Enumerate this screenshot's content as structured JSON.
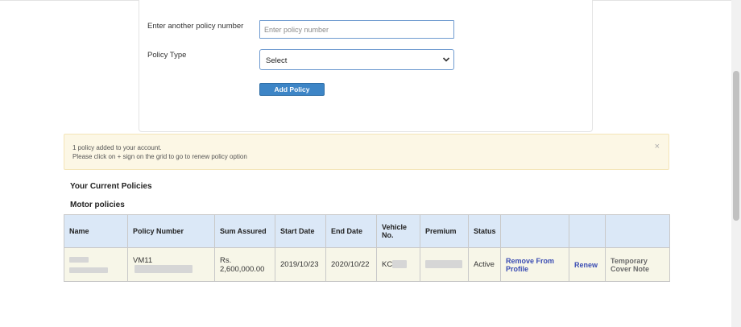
{
  "form": {
    "policy_number_label": "Enter another policy number",
    "policy_number_placeholder": "Enter policy number",
    "policy_type_label": "Policy Type",
    "policy_type_value": "Select",
    "add_button": "Add Policy"
  },
  "alert": {
    "line1": "1 policy added to your account.",
    "line2": "Please click on + sign on the grid to go to renew policy option",
    "close": "×"
  },
  "sections": {
    "current": "Your Current Policies",
    "motor": "Motor policies"
  },
  "table": {
    "headers": [
      "Name",
      "Policy Number",
      "Sum Assured",
      "Start Date",
      "End Date",
      "Vehicle No.",
      "Premium",
      "Status",
      "",
      "",
      ""
    ],
    "row": {
      "policy_prefix": "VM11",
      "sum_assured": "Rs. 2,600,000.00",
      "start_date": "2019/10/23",
      "end_date": "2020/10/22",
      "vehicle_prefix": "KC",
      "status": "Active",
      "remove": "Remove From Profile",
      "renew": "Renew",
      "temp_cover": "Temporary Cover Note"
    }
  },
  "icons": {
    "select_arrow": "chevron-down-icon",
    "alert_close": "close-icon"
  },
  "colors": {
    "button": "#3d85c6",
    "alert_bg": "#fcf7e5",
    "header_bg": "#dbe8f7",
    "row_bg": "#f7f6e8",
    "link": "#3b4db3"
  }
}
